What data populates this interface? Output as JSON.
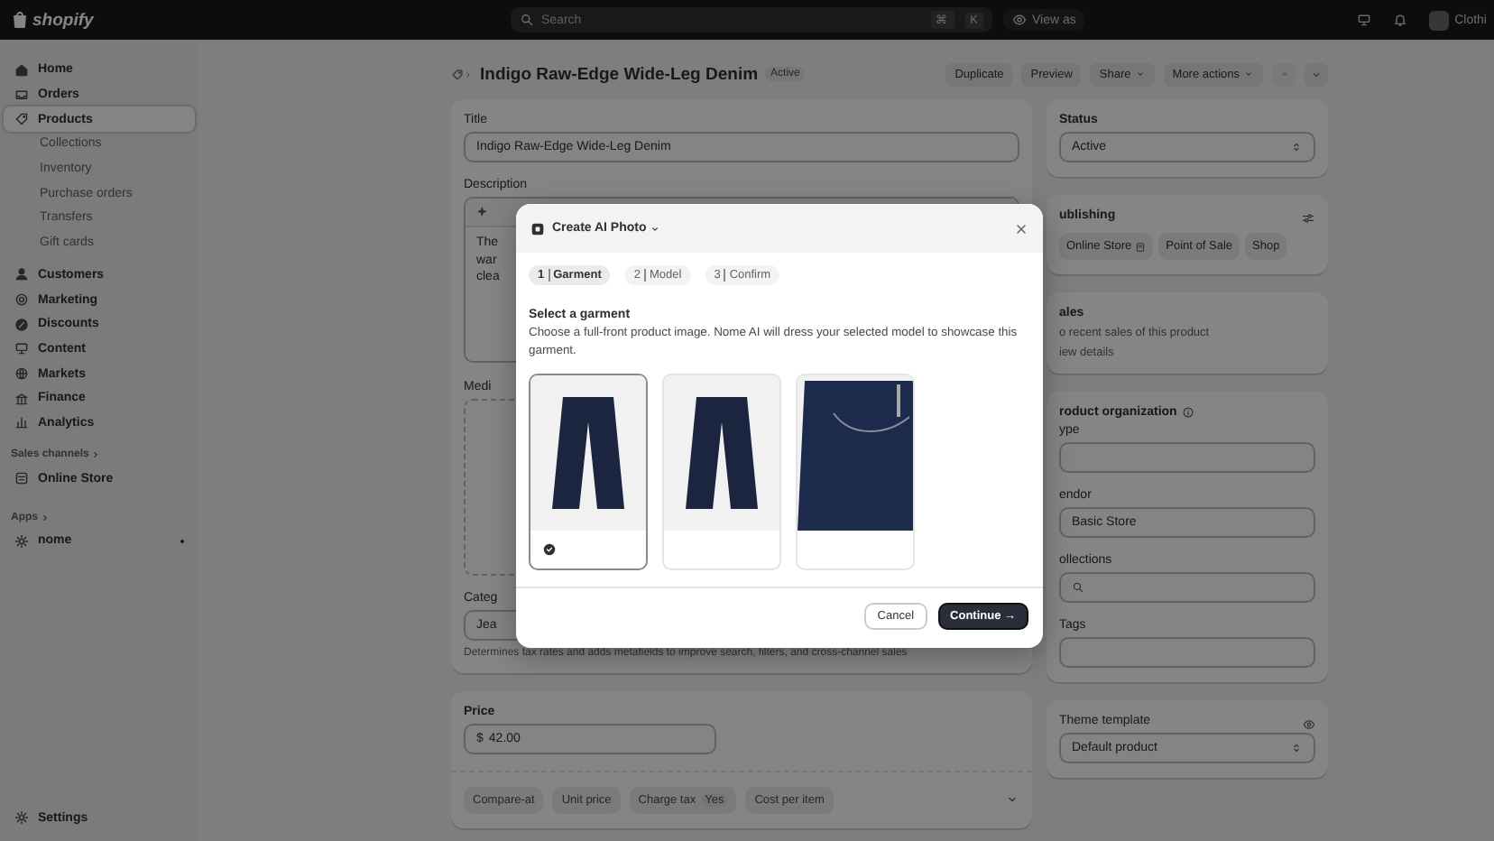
{
  "topbar": {
    "logo": "shopify",
    "search_placeholder": "Search",
    "shortcut": [
      "⌘",
      "K"
    ],
    "view_as": "View as",
    "store": "Clothi"
  },
  "sidebar": {
    "items": [
      {
        "label": "Home",
        "selected": false
      },
      {
        "label": "Orders",
        "selected": false
      },
      {
        "label": "Products",
        "selected": true,
        "children": [
          {
            "label": "Collections",
            "selected": false
          },
          {
            "label": "Inventory",
            "selected": false
          },
          {
            "label": "Purchase orders",
            "selected": false
          },
          {
            "label": "Transfers",
            "selected": false
          },
          {
            "label": "Gift cards",
            "selected": false
          }
        ]
      },
      {
        "label": "Customers",
        "selected": false
      },
      {
        "label": "Marketing",
        "selected": false
      },
      {
        "label": "Discounts",
        "selected": false
      },
      {
        "label": "Content",
        "selected": false
      },
      {
        "label": "Markets",
        "selected": false
      },
      {
        "label": "Finance",
        "selected": false
      },
      {
        "label": "Analytics",
        "selected": false
      }
    ],
    "sales_channels": {
      "heading": "Sales channels",
      "items": [
        {
          "label": "Online Store",
          "selected": false
        }
      ]
    },
    "apps": {
      "heading": "Apps",
      "items": [
        {
          "label": "nome",
          "selected": false
        }
      ]
    },
    "settings": "Settings"
  },
  "page": {
    "title": "Indigo Raw-Edge Wide-Leg Denim",
    "status_badge": "Active",
    "actions": [
      {
        "label": "Duplicate",
        "kind": "plain"
      },
      {
        "label": "Preview",
        "kind": "plain"
      },
      {
        "label": "Share",
        "kind": "menu"
      },
      {
        "label": "More actions",
        "kind": "menu"
      }
    ],
    "product_card": {
      "title_label": "Title",
      "title_value": "Indigo Raw-Edge Wide-Leg Denim",
      "description_label": "Description",
      "description_lines": [
        "The",
        "war",
        "clea"
      ],
      "media_label": "Medi",
      "category_label": "Categ",
      "category_value": "Jea",
      "category_help": "Determines tax rates and adds metafields to improve search, filters, and cross-channel sales"
    },
    "price_card": {
      "label": "Price",
      "currency": "$",
      "value": "42.00",
      "chips": [
        {
          "label": "Compare-at"
        },
        {
          "label": "Unit price"
        },
        {
          "label": "Charge tax",
          "badge": "Yes"
        },
        {
          "label": "Cost per item"
        }
      ]
    },
    "status_card": {
      "label": "Status",
      "value": "Active"
    },
    "publishing_card": {
      "title": "ublishing",
      "channels": [
        "Online Store",
        "Point of Sale",
        "Shop"
      ]
    },
    "sales_card": {
      "title": "ales",
      "text": "o recent sales of this product",
      "link": "iew details"
    },
    "organization_card": {
      "title": "roduct organization",
      "fields": [
        {
          "label": "ype",
          "kind": "text"
        },
        {
          "label": "endor",
          "kind": "text",
          "value": "Basic Store"
        },
        {
          "label": "ollections",
          "kind": "search"
        },
        {
          "label": "Tags",
          "kind": "text"
        }
      ]
    },
    "theme_card": {
      "label": "Theme template",
      "value": "Default product"
    }
  },
  "modal": {
    "title": "Create AI Photo",
    "steps": [
      {
        "number": "1",
        "label": "Garment",
        "selected": true
      },
      {
        "number": "2",
        "label": "Model",
        "selected": false
      },
      {
        "number": "3",
        "label": "Confirm",
        "selected": false
      }
    ],
    "heading": "Select a garment",
    "description": "Choose a full-front product image. Nome AI will dress your selected model to showcase this garment.",
    "garments": [
      {
        "kind": "front",
        "selected": true
      },
      {
        "kind": "front",
        "selected": false
      },
      {
        "kind": "closeup",
        "selected": false
      }
    ],
    "buttons": [
      {
        "label": "Cancel",
        "kind": "secondary"
      },
      {
        "label": "Continue →",
        "kind": "primary"
      }
    ]
  }
}
